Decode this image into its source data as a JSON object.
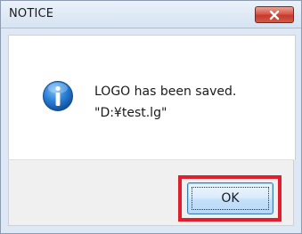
{
  "window": {
    "title": "NOTICE"
  },
  "titlebar": {
    "close_icon": "close-icon",
    "close_color": "#c9473a"
  },
  "message": {
    "icon": "info-icon",
    "line1": "LOGO has been saved.",
    "line2": "\"D:¥test.lg\""
  },
  "buttons": {
    "ok_label": "OK"
  },
  "colors": {
    "highlight": "#e01e2e",
    "info_blue": "#1f6fc0"
  }
}
